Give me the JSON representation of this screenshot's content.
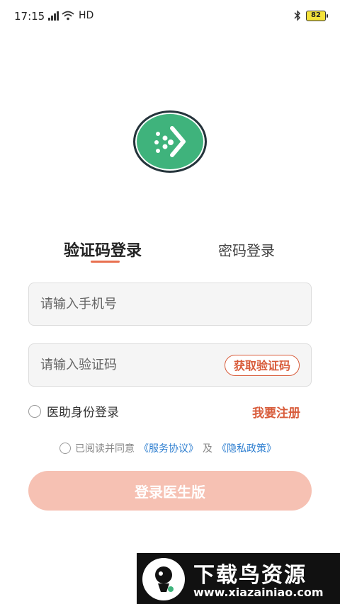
{
  "status_bar": {
    "time": "17:15",
    "network": "HD",
    "battery": "82"
  },
  "tabs": [
    {
      "label": "验证码登录",
      "active": true
    },
    {
      "label": "密码登录",
      "active": false
    }
  ],
  "form": {
    "phone_placeholder": "请输入手机号",
    "code_placeholder": "请输入验证码",
    "get_code_label": "获取验证码"
  },
  "assist_login_label": "医助身份登录",
  "register_label": "我要注册",
  "agreement": {
    "prefix": "已阅读并同意",
    "service_link": "《服务协议》",
    "conjunction": "及",
    "privacy_link": "《隐私政策》"
  },
  "login_button_label": "登录医生版",
  "watermark": {
    "title": "下载鸟资源",
    "url": "www.xiazainiao.com"
  },
  "colors": {
    "brand_green": "#3fb37c",
    "accent": "#d85b3a",
    "link": "#2f7fd0",
    "button_disabled": "#f6c1b3"
  }
}
